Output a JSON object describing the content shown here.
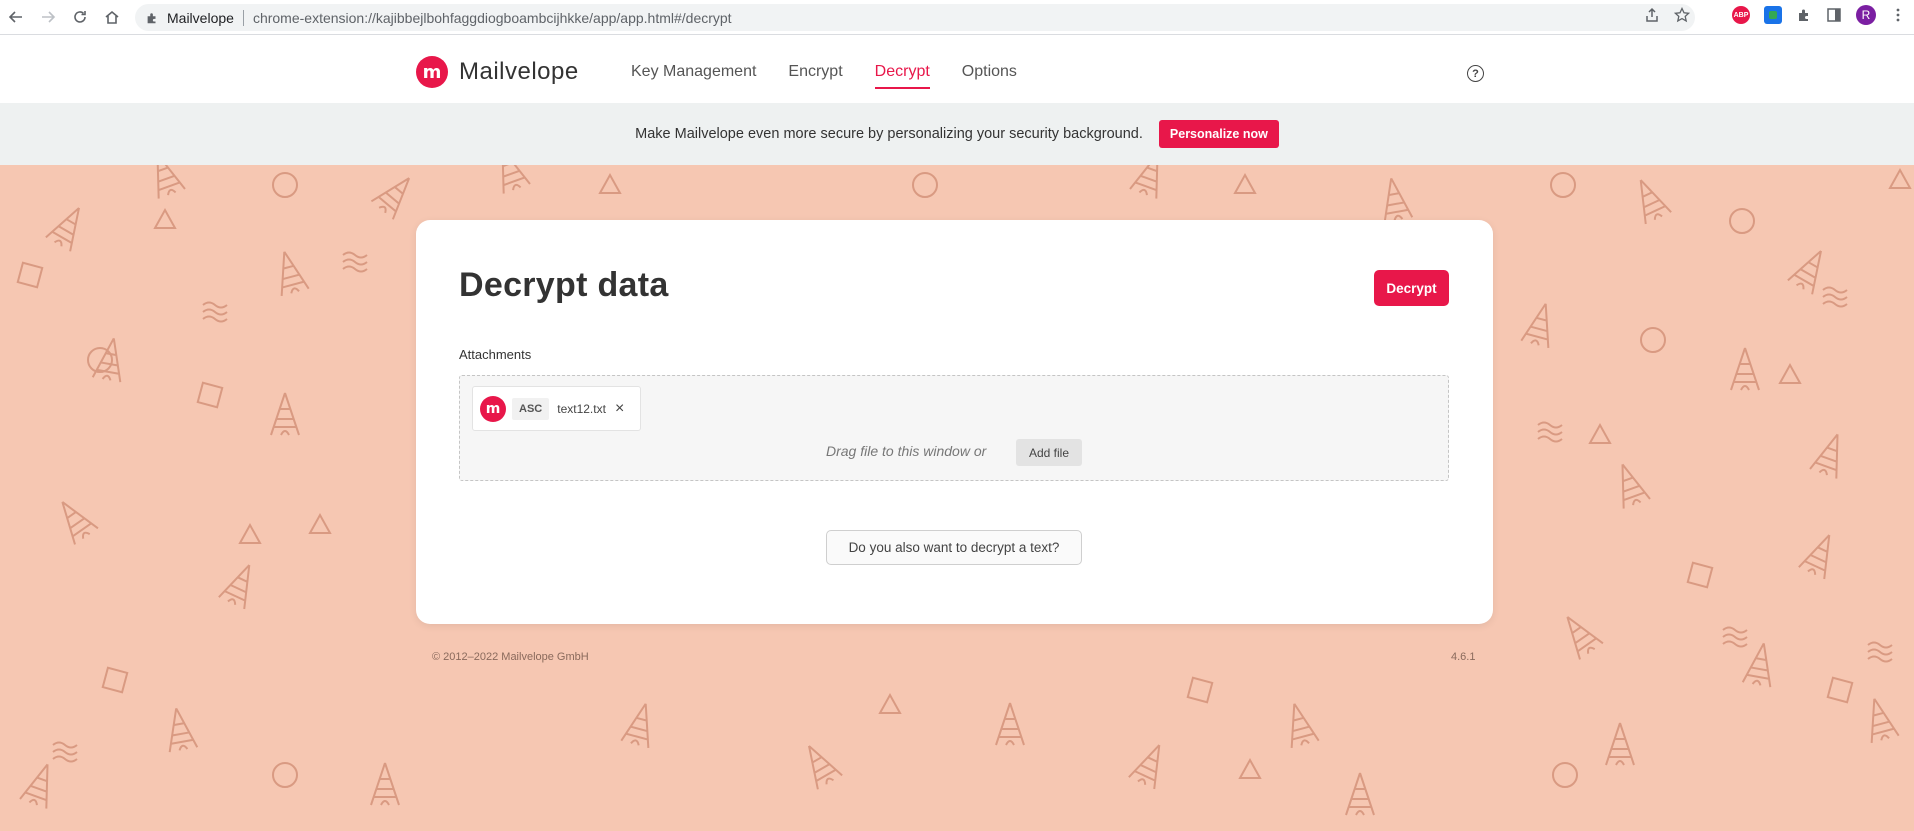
{
  "browser": {
    "site_name": "Mailvelope",
    "url": "chrome-extension://kajibbejlbohfaggdiogboambcijhkke/app/app.html#/decrypt",
    "abp_label": "ABP",
    "avatar_initial": "R"
  },
  "app": {
    "logo_text": "Mailvelope",
    "logo_mark": "m",
    "nav": [
      {
        "label": "Key Management",
        "active": false
      },
      {
        "label": "Encrypt",
        "active": false
      },
      {
        "label": "Decrypt",
        "active": true
      },
      {
        "label": "Options",
        "active": false
      }
    ],
    "help_glyph": "?"
  },
  "banner": {
    "text": "Make Mailvelope even more secure by personalizing your security background.",
    "button_label": "Personalize now"
  },
  "card": {
    "title": "Decrypt data",
    "decrypt_label": "Decrypt",
    "attachments_label": "Attachments",
    "attachment": {
      "logo_mark": "m",
      "ext": "ASC",
      "name": "text12.txt",
      "remove_glyph": "×"
    },
    "drop_hint": "Drag file to this window or",
    "add_file_label": "Add file",
    "text_question": "Do you also want to decrypt a text?"
  },
  "footer": {
    "copyright": "© 2012–2022  Mailvelope GmbH",
    "version": "4.6.1"
  },
  "colors": {
    "accent": "#e8174a",
    "background": "#f6c7b2"
  }
}
